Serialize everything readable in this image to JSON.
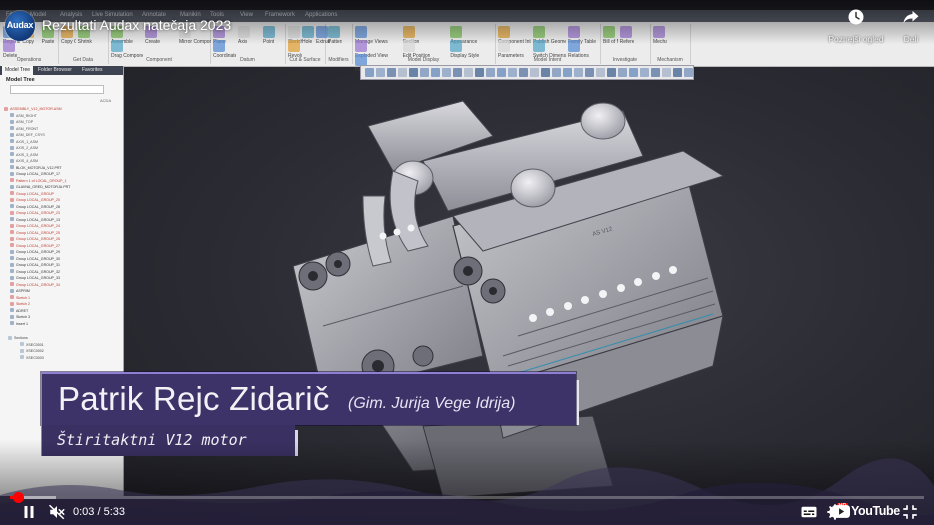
{
  "video": {
    "title": "Rezultati Audax natečaja 2023",
    "channel_avatar_text": "Audax"
  },
  "header_actions": {
    "watch_later_label": "Poznejši ogled",
    "share_label": "Deli"
  },
  "lower_third": {
    "name": "Patrik Rejc Zidarič",
    "school": "(Gim. Jurija Vege Idrija)",
    "project": "Štiritaktni V12 motor"
  },
  "player": {
    "current_time": "0:03",
    "duration": "5:33",
    "time_separator": " / ",
    "progress_fraction": 0.009,
    "buffer_fraction": 0.05,
    "youtube_label": "YouTube",
    "hd_badge": "HD"
  },
  "colors": {
    "progress_played": "#ff0000",
    "banner_purple": "#3d3369",
    "banner_border": "#8f7fd1"
  },
  "cad": {
    "ribbon_tabs": [
      "File",
      "Model",
      "Analysis",
      "Live Simulation",
      "Annotate",
      "Manikin",
      "Tools",
      "View",
      "Framework",
      "Applications"
    ],
    "ribbon_groups": [
      {
        "label": "Operations",
        "items": [
          "Regenerate",
          "Copy",
          "Paste",
          "Delete"
        ]
      },
      {
        "label": "Get Data",
        "items": [
          "Copy Geometry",
          "Shrinkwrap"
        ]
      },
      {
        "label": "Component",
        "items": [
          "Assemble",
          "Create",
          "Mirror Component",
          "Drag Components"
        ]
      },
      {
        "label": "Datum",
        "items": [
          "Plane",
          "Axis",
          "Point",
          "Coordinate System"
        ]
      },
      {
        "label": "Cut & Surface",
        "items": [
          "Sketch",
          "Hole",
          "Extrude",
          "Revolve"
        ]
      },
      {
        "label": "Modifiers",
        "items": [
          "Pattern"
        ]
      },
      {
        "label": "Model Display",
        "items": [
          "Manage Views",
          "Section",
          "Appearance",
          "Exploded View",
          "Edit Position",
          "Display Style",
          "Perspective View"
        ]
      },
      {
        "label": "Model Intent",
        "items": [
          "Component Interface",
          "Publish Geometry",
          "Family Table",
          "Parameters",
          "Switch Dimensions",
          "Relations"
        ]
      },
      {
        "label": "Investigate",
        "items": [
          "Bill of Materials",
          "Reference Viewer"
        ]
      },
      {
        "label": "Mechanism",
        "items": [
          "Mechanism"
        ]
      }
    ],
    "panel_tabs": [
      "Model Tree",
      "Folder Browser",
      "Favorites"
    ],
    "tree_title": "Model Tree",
    "tree_column": "ACDA",
    "tree_items": [
      {
        "label": "ASSEMBLY_V12_MOTOR.ASM",
        "color": "#c0392b"
      },
      {
        "label": "ASM_RIGHT",
        "color": "#555"
      },
      {
        "label": "ASM_TOP",
        "color": "#555"
      },
      {
        "label": "ASM_FRONT",
        "color": "#555"
      },
      {
        "label": "ASM_DEF_CSYS",
        "color": "#555"
      },
      {
        "label": "AXIS_1_ASM",
        "color": "#555"
      },
      {
        "label": "AXIS_2_ASM",
        "color": "#555"
      },
      {
        "label": "AXIS_3_ASM",
        "color": "#555"
      },
      {
        "label": "AXIS_4_ASM",
        "color": "#555"
      },
      {
        "label": "BLOK_MOTORJA_V12.PRT",
        "color": "#333"
      },
      {
        "label": "Group LOCAL_GROUP_17",
        "color": "#333"
      },
      {
        "label": "Pattern 1 of LOCAL_GROUP_1",
        "color": "#c0392b"
      },
      {
        "label": "GLAVNA_GRED_MOTORJA.PRT",
        "color": "#333"
      },
      {
        "label": "Group LOCAL_GROUP",
        "color": "#c0392b"
      },
      {
        "label": "Group LOCAL_GROUP_20",
        "color": "#c0392b"
      },
      {
        "label": "Group LOCAL_GROUP_28",
        "color": "#333"
      },
      {
        "label": "Group LOCAL_GROUP_23",
        "color": "#c0392b"
      },
      {
        "label": "Group LOCAL_GROUP_13",
        "color": "#333"
      },
      {
        "label": "Group LOCAL_GROUP_24",
        "color": "#c0392b"
      },
      {
        "label": "Group LOCAL_GROUP_25",
        "color": "#c0392b"
      },
      {
        "label": "Group LOCAL_GROUP_26",
        "color": "#c0392b"
      },
      {
        "label": "Group LOCAL_GROUP_27",
        "color": "#c0392b"
      },
      {
        "label": "Group LOCAL_GROUP_29",
        "color": "#333"
      },
      {
        "label": "Group LOCAL_GROUP_30",
        "color": "#333"
      },
      {
        "label": "Group LOCAL_GROUP_31",
        "color": "#333"
      },
      {
        "label": "Group LOCAL_GROUP_32",
        "color": "#333"
      },
      {
        "label": "Group LOCAL_GROUP_33",
        "color": "#333"
      },
      {
        "label": "Group LOCAL_GROUP_34",
        "color": "#c0392b"
      },
      {
        "label": "ASPRIM",
        "color": "#333"
      },
      {
        "label": "Sketch 1",
        "color": "#c0392b"
      },
      {
        "label": "Sketch 2",
        "color": "#c0392b"
      },
      {
        "label": "ADRET",
        "color": "#333"
      },
      {
        "label": "Sketch 3",
        "color": "#333"
      },
      {
        "label": "Insert 1",
        "color": "#333"
      }
    ],
    "tree_sections": [
      {
        "label": "Sections"
      },
      {
        "label": "XSEC0001"
      },
      {
        "label": "XSEC0002"
      },
      {
        "label": "XSEC0003"
      }
    ]
  }
}
